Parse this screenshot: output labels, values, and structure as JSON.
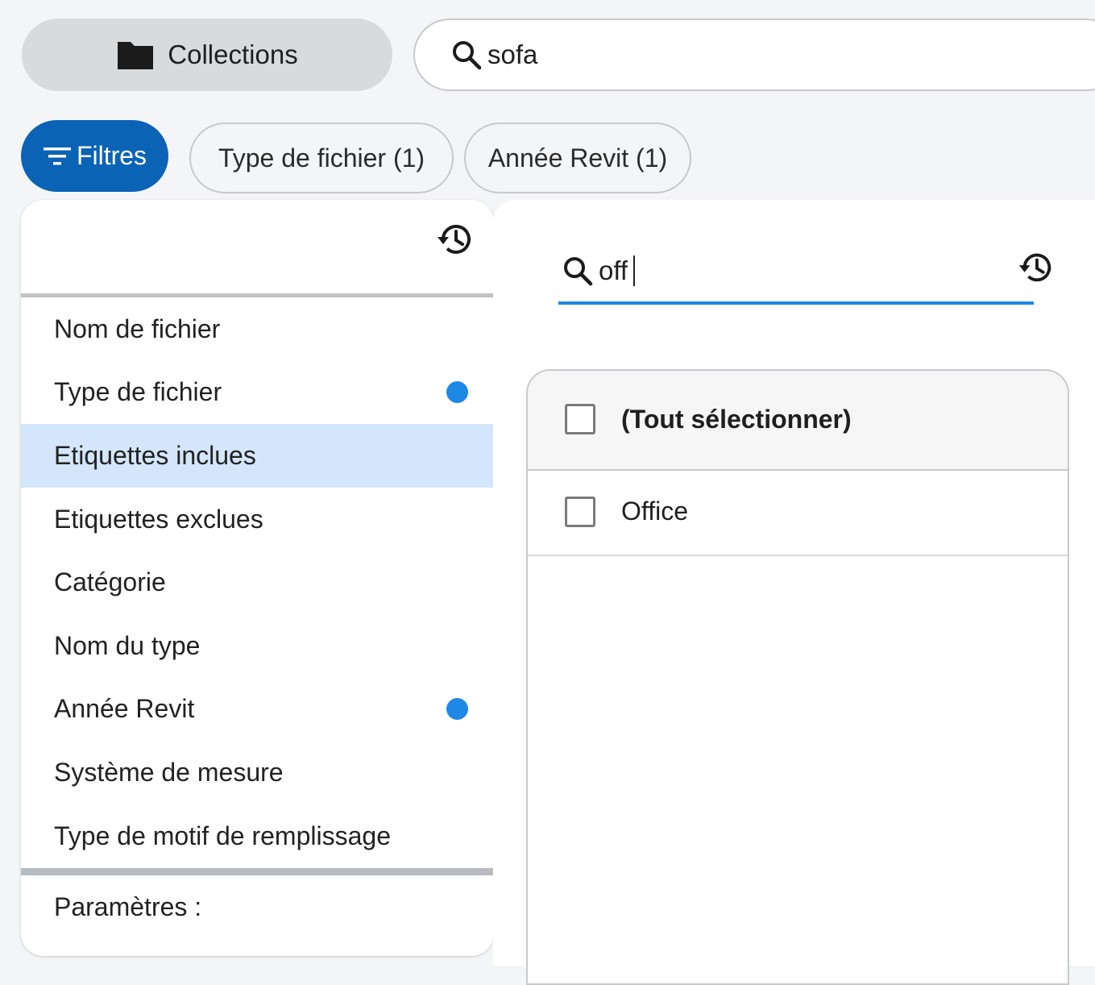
{
  "topbar": {
    "collections_label": "Collections",
    "search_value": "sofa"
  },
  "filters": {
    "filters_label": "Filtres",
    "chips": [
      {
        "label": "Type de fichier (1)"
      },
      {
        "label": "Année Revit (1)"
      }
    ]
  },
  "left_panel": {
    "items": [
      {
        "label": "Nom de fichier",
        "active": false,
        "dot": false
      },
      {
        "label": "Type de fichier",
        "active": false,
        "dot": true
      },
      {
        "label": "Etiquettes inclues",
        "active": true,
        "dot": false
      },
      {
        "label": "Etiquettes exclues",
        "active": false,
        "dot": false
      },
      {
        "label": "Catégorie",
        "active": false,
        "dot": false
      },
      {
        "label": "Nom du type",
        "active": false,
        "dot": false
      },
      {
        "label": "Année Revit",
        "active": false,
        "dot": true
      },
      {
        "label": "Système de mesure",
        "active": false,
        "dot": false
      },
      {
        "label": "Type de motif de remplissage",
        "active": false,
        "dot": false
      }
    ],
    "parameters_label": "Paramètres :"
  },
  "right_panel": {
    "search_value": "off",
    "select_all_label": "(Tout sélectionner)",
    "options": [
      {
        "label": "Office",
        "checked": false
      }
    ]
  },
  "colors": {
    "accent": "#0b63b6",
    "active_row": "#d3e6fb",
    "dot": "#1e88e5"
  },
  "icons": {
    "collections": "folder-icon",
    "search": "search-icon",
    "filters": "filter-lines-icon",
    "history": "history-icon"
  }
}
